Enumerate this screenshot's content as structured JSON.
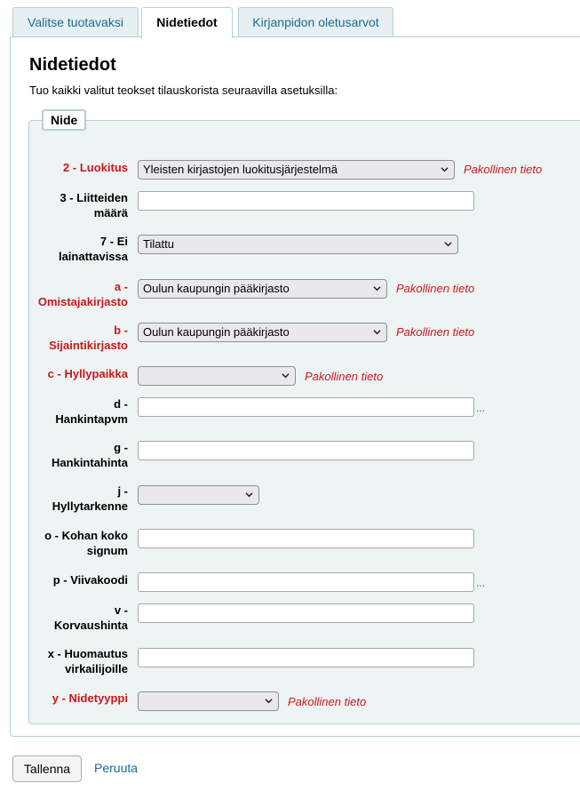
{
  "tabs": [
    {
      "label": "Valitse tuotavaksi"
    },
    {
      "label": "Nidetiedot"
    },
    {
      "label": "Kirjanpidon oletusarvot"
    }
  ],
  "page_title": "Nidetiedot",
  "intro": "Tuo kaikki valitut teokset tilauskorista seuraavilla asetuksilla:",
  "fieldset_legend": "Nide",
  "required_note": "Pakollinen tieto",
  "fields": {
    "luokitus": {
      "label": "2 - Luokitus",
      "value": "Yleisten kirjastojen luokitusjärjestelmä"
    },
    "liitteiden_maara": {
      "label_line1": "3 - Liitteiden",
      "label_line2": "määrä",
      "value": ""
    },
    "ei_lainattavissa": {
      "label_line1": "7 - Ei",
      "label_line2": "lainattavissa",
      "value": "Tilattu"
    },
    "omistajakirjasto": {
      "label_line1": "a -",
      "label_line2": "Omistajakirjasto",
      "value": "Oulun kaupungin pääkirjasto"
    },
    "sijaintikirjasto": {
      "label_line1": "b -",
      "label_line2": "Sijaintikirjasto",
      "value": "Oulun kaupungin pääkirjasto"
    },
    "hyllypaikka": {
      "label": "c - Hyllypaikka",
      "value": ""
    },
    "hankintapvm": {
      "label_line1": "d -",
      "label_line2": "Hankintapvm",
      "value": "",
      "extra": "..."
    },
    "hankintahinta": {
      "label_line1": "g -",
      "label_line2": "Hankintahinta",
      "value": ""
    },
    "hyllytarkenne": {
      "label_line1": "j -",
      "label_line2": "Hyllytarkenne",
      "value": ""
    },
    "kohan_koko_signum": {
      "label_line1": "o - Kohan koko",
      "label_line2": "signum",
      "value": ""
    },
    "viivakoodi": {
      "label": "p - Viivakoodi",
      "value": "",
      "extra": "..."
    },
    "korvaushinta": {
      "label_line1": "v -",
      "label_line2": "Korvaushinta",
      "value": ""
    },
    "huomautus": {
      "label_line1": "x - Huomautus",
      "label_line2": "virkailijoille",
      "value": ""
    },
    "nidetyyppi": {
      "label": "y - Nidetyyppi",
      "value": ""
    }
  },
  "buttons": {
    "save": "Tallenna",
    "cancel": "Peruuta"
  },
  "colors": {
    "required": "#c9181e",
    "link": "#1d6a94",
    "fieldset_bg": "#eef3f3",
    "border": "#b7cfd7"
  }
}
